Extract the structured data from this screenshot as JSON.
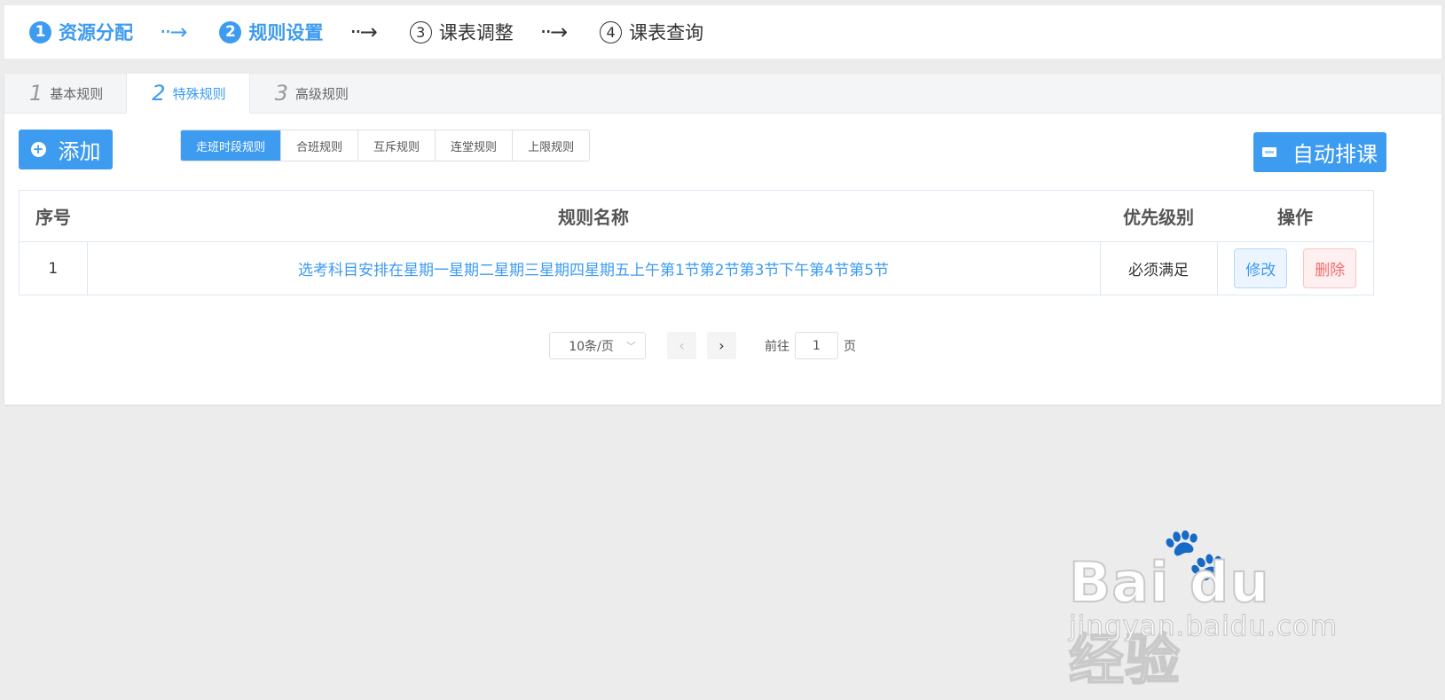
{
  "steps": [
    {
      "num": "1",
      "label": "资源分配"
    },
    {
      "num": "2",
      "label": "规则设置"
    },
    {
      "num": "3",
      "label": "课表调整"
    },
    {
      "num": "4",
      "label": "课表查询"
    }
  ],
  "step_arrow": "··→",
  "tabs": [
    {
      "num": "1",
      "label": "基本规则"
    },
    {
      "num": "2",
      "label": "特殊规则"
    },
    {
      "num": "3",
      "label": "高级规则"
    }
  ],
  "toolbar": {
    "add_label": "添加",
    "auto_schedule_label": "自动排课"
  },
  "segments": [
    "走班时段规则",
    "合班规则",
    "互斥规则",
    "连堂规则",
    "上限规则"
  ],
  "table": {
    "headers": [
      "序号",
      "规则名称",
      "优先级别",
      "操作"
    ],
    "rows": [
      {
        "index": "1",
        "name": "选考科目安排在星期一星期二星期三星期四星期五上午第1节第2节第3节下午第4节第5节",
        "priority": "必须满足",
        "edit": "修改",
        "delete": "删除"
      }
    ]
  },
  "pager": {
    "page_size": "10条/页",
    "goto_label": "前往",
    "current_page": "1",
    "page_suffix": "页"
  },
  "watermark": {
    "main": "Bai du 经验",
    "sub": "jingyan.baidu.com"
  },
  "colors": {
    "accent": "#3d9bf0",
    "danger": "#f56c6c",
    "background": "#ececec"
  }
}
